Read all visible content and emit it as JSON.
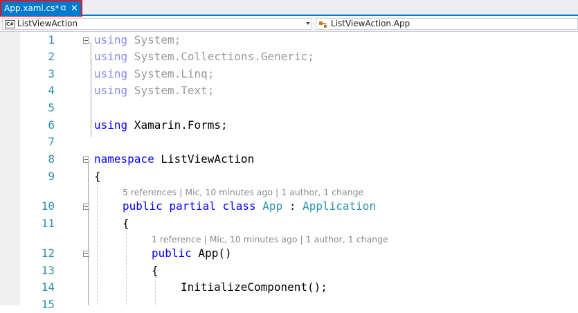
{
  "tab": {
    "title": "App.xaml.cs*",
    "pin_icon": "pin-icon",
    "close_glyph": "✕"
  },
  "navbar": {
    "project": "ListViewAction",
    "project_icon_text": "C#",
    "member": "ListViewAction.App"
  },
  "editor": {
    "line_numbers": [
      "1",
      "2",
      "3",
      "4",
      "5",
      "6",
      "7",
      "8",
      "9",
      "10",
      "11",
      "12",
      "13",
      "14",
      "15"
    ],
    "code": {
      "l1_kw": "using",
      "l1_rest": " System;",
      "l2_kw": "using",
      "l2_rest": " System.Collections.Generic;",
      "l3_kw": "using",
      "l3_rest": " System.Linq;",
      "l4_kw": "using",
      "l4_rest": " System.Text;",
      "l6_kw": "using",
      "l6_rest": " Xamarin.Forms;",
      "l8_kw": "namespace",
      "l8_rest": " ListViewAction",
      "l9": "{",
      "l10_kw": "public partial class",
      "l10_type": "App",
      "l10_colon": " : ",
      "l10_base": "Application",
      "l11": "{",
      "l12_kw": "public",
      "l12_rest": " App()",
      "l13": "{",
      "l14": "InitializeComponent();"
    },
    "codelens_class": "5 references | Mic, 10 minutes ago | 1 author, 1 change",
    "codelens_ctor": "1 reference | Mic, 10 minutes ago | 1 author, 1 change"
  }
}
